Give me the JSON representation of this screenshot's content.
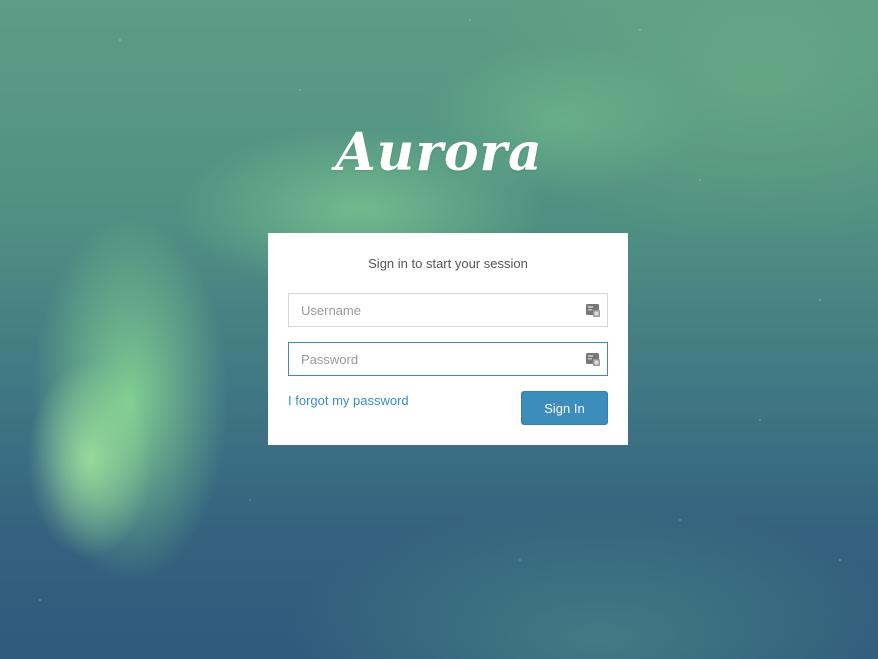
{
  "brand": {
    "logo_text": "Aurora"
  },
  "login": {
    "message": "Sign in to start your session",
    "username": {
      "placeholder": "Username",
      "value": "",
      "icon": "id-card-icon"
    },
    "password": {
      "placeholder": "Password",
      "value": "",
      "icon": "id-card-icon"
    },
    "forgot_label": "I forgot my password",
    "signin_label": "Sign In"
  },
  "colors": {
    "accent": "#3c8dbc",
    "box_background": "#ffffff",
    "sky_top": "#5d9d86",
    "sky_bottom": "#2f5a7c",
    "aurora_glow": "#96eb96"
  }
}
